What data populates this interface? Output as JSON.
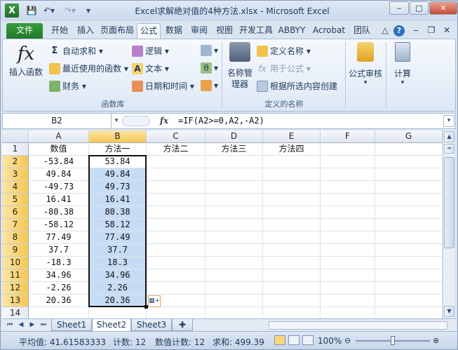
{
  "window": {
    "title": "Excel求解绝对值的4种方法.xlsx - Microsoft Excel",
    "app_icon": "X",
    "min": "‒",
    "max": "□",
    "close": "✕"
  },
  "tabs": [
    "文件",
    "开始",
    "插入",
    "页面布局",
    "公式",
    "数据",
    "审阅",
    "视图",
    "开发工具",
    "ABBYY",
    "Acrobat",
    "团队"
  ],
  "ribbon": {
    "insert_function": "插入函数",
    "autosum": "自动求和",
    "recent": "最近使用的函数",
    "finance": "财务",
    "logic": "逻辑",
    "text": "文本",
    "datetime": "日期和时间",
    "group_library": "函数库",
    "name_manager": "名称管理器",
    "define_name": "定义名称",
    "use_in_formula": "用于公式",
    "create_from_selection": "根据所选内容创建",
    "group_names": "定义的名称",
    "formula_audit": "公式审核",
    "calculation": "计算"
  },
  "formula_bar": {
    "name_box": "B2",
    "fx": "fx",
    "formula": "=IF(A2>=0,A2,-A2)"
  },
  "sheet": {
    "columns": [
      "A",
      "B",
      "C",
      "D",
      "E",
      "F",
      "G"
    ],
    "rows": [
      "1",
      "2",
      "3",
      "4",
      "5",
      "6",
      "7",
      "8",
      "9",
      "10",
      "11",
      "12",
      "13",
      "14"
    ],
    "headers": [
      "数值",
      "方法一",
      "方法二",
      "方法三",
      "方法四"
    ],
    "colA": [
      "-53.84",
      "49.84",
      "-49.73",
      "16.41",
      "-80.38",
      "-58.12",
      "77.49",
      "37.7",
      "-18.3",
      "34.96",
      "-2.26",
      "20.36"
    ],
    "colB": [
      "53.84",
      "49.84",
      "49.73",
      "16.41",
      "80.38",
      "58.12",
      "77.49",
      "37.7",
      "18.3",
      "34.96",
      "2.26",
      "20.36"
    ]
  },
  "sheet_tabs": [
    "Sheet1",
    "Sheet2",
    "Sheet3"
  ],
  "status": {
    "average": "平均值: 41.61583333",
    "count": "计数: 12",
    "numeric_count": "数值计数: 12",
    "sum": "求和: 499.39",
    "zoom": "100%"
  }
}
